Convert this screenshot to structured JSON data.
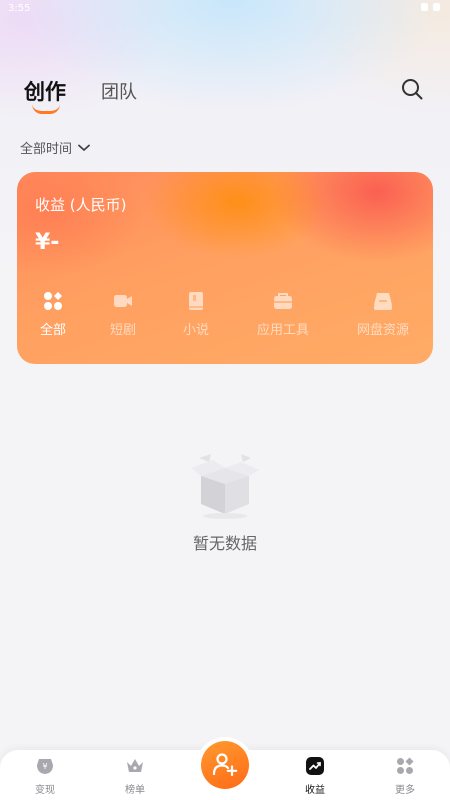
{
  "status_bar": {
    "time": "3:55"
  },
  "header": {
    "tabs": [
      {
        "label": "创作",
        "active": true
      },
      {
        "label": "团队",
        "active": false
      }
    ],
    "search_icon": "search-icon"
  },
  "filter": {
    "label": "全部时间",
    "icon": "chevron-down-icon"
  },
  "earnings_card": {
    "title": "收益 (人民币)",
    "amount": "¥-",
    "categories": [
      {
        "label": "全部",
        "icon": "grid-icon",
        "active": true
      },
      {
        "label": "短剧",
        "icon": "video-camera-icon",
        "active": false
      },
      {
        "label": "小说",
        "icon": "book-icon",
        "active": false
      },
      {
        "label": "应用工具",
        "icon": "toolbox-icon",
        "active": false
      },
      {
        "label": "网盘资源",
        "icon": "drive-icon",
        "active": false
      }
    ]
  },
  "empty_state": {
    "text": "暂无数据",
    "icon": "empty-box-icon"
  },
  "bottom_nav": {
    "items": [
      {
        "label": "变现",
        "icon": "coin-icon",
        "active": false
      },
      {
        "label": "榜单",
        "icon": "crown-icon",
        "active": false
      },
      {
        "label": "收益",
        "icon": "trend-chart-icon",
        "active": true
      },
      {
        "label": "更多",
        "icon": "apps-icon",
        "active": false
      }
    ],
    "center_icon": "add-person-icon"
  },
  "colors": {
    "accent": "#ff7a21",
    "card_gradient_start": "#ff8a5c",
    "card_gradient_end": "#ffab66",
    "background": "#f4f4f7"
  }
}
